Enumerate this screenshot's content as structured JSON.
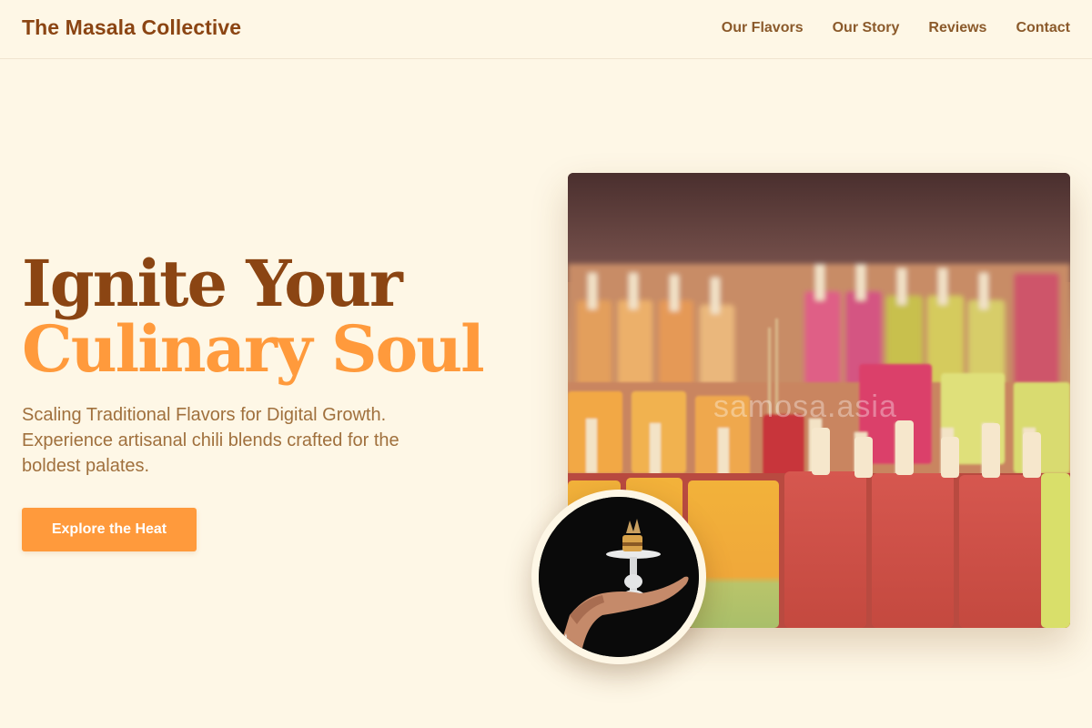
{
  "header": {
    "brand": "The Masala Collective",
    "nav": [
      "Our Flavors",
      "Our Story",
      "Reviews",
      "Contact"
    ]
  },
  "hero": {
    "title_line1": "Ignite Your",
    "title_line2": "Culinary Soul",
    "subtitle": "Scaling Traditional Flavors for Digital Growth. Experience artisanal chili blends crafted for the boldest palates.",
    "cta_label": "Explore the Heat"
  },
  "images": {
    "main_watermark": "samosa.asia",
    "main_subject": "popsicles-display",
    "circle_subject": "hand-holding-dessert-stand"
  },
  "colors": {
    "background": "#fef7e6",
    "brand_brown": "#8b4513",
    "accent_orange": "#ff9a3c",
    "nav_text": "#8b5a2b",
    "body_text": "#a0703d"
  }
}
